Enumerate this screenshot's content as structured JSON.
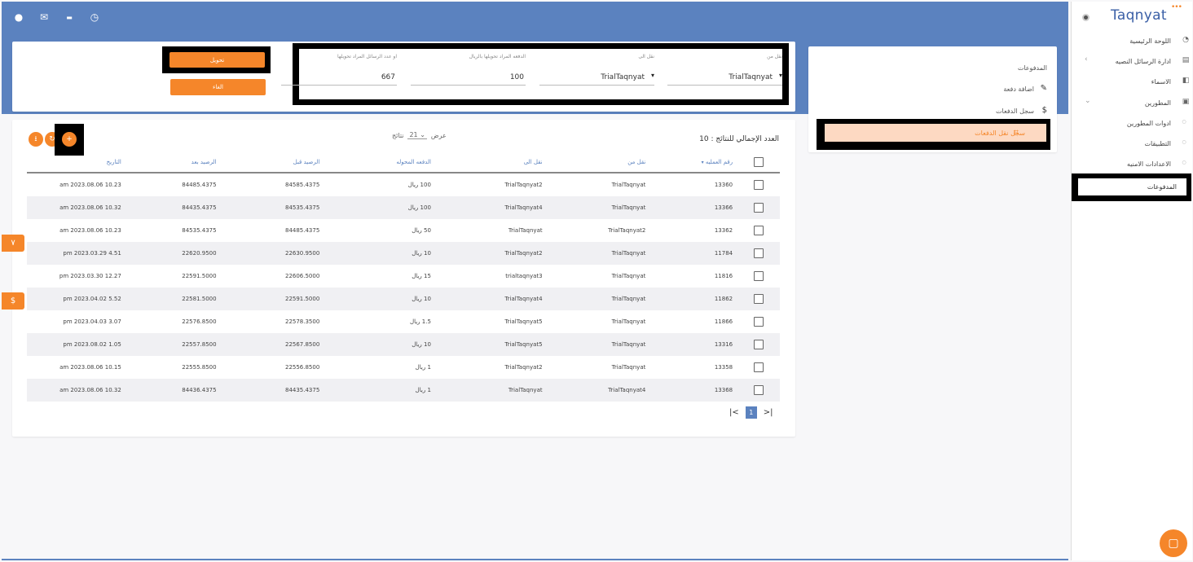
{
  "brand": {
    "name": "Taqnyat",
    "dots": "•••"
  },
  "topbar": {
    "icons": [
      "user-icon",
      "mail-icon",
      "flag-icon",
      "clock-icon"
    ]
  },
  "sidebar": {
    "items": [
      {
        "label": "اللوحة الرئيسية",
        "icon": "dashboard-icon"
      },
      {
        "label": "ادارة الرسائل النصيه",
        "icon": "message-icon"
      },
      {
        "label": "الاسماء",
        "icon": "book-icon"
      },
      {
        "label": "المطورين",
        "icon": "code-icon"
      },
      {
        "label": "ادوات المطورين",
        "icon": "bullet-icon"
      },
      {
        "label": "التطبيقات",
        "icon": "bullet-icon"
      },
      {
        "label": "الاعدادات الامنيه",
        "icon": "bullet-icon"
      },
      {
        "label": "المدفوعات",
        "icon": "bullet-icon"
      }
    ]
  },
  "form": {
    "transfer_button": "تحويل",
    "cancel_button": "الغاء",
    "fields": [
      {
        "label": "نقل من",
        "value": "TrialTaqnyat"
      },
      {
        "label": "نقل الى",
        "value": "TrialTaqnyat"
      },
      {
        "label": "الدفعه المراد تحويلها بالريال",
        "value": "100"
      },
      {
        "label": "او عدد الرسائل المراد تحويلها",
        "value": "667"
      }
    ]
  },
  "payments_card": {
    "title": "المدفوعات",
    "items": [
      {
        "label": "اضافة دفعة",
        "icon": "pencil-icon"
      },
      {
        "label": "سجل الدفعات",
        "icon": "dollar-icon"
      },
      {
        "label": "سجل نقل الدفعات",
        "icon": "crop-icon"
      }
    ]
  },
  "table": {
    "total_label": "العدد الإجمالي للنتائج : 10",
    "show_label": "عرض",
    "per_page": "21",
    "results_label": "نتائج",
    "columns": [
      "رقم العمليه",
      "نقل من",
      "نقل الى",
      "الدفعه المحوله",
      "الرصيد قبل",
      "الرصيد بعد",
      "التاريخ"
    ],
    "rows": [
      [
        "13360",
        "TrialTaqnyat",
        "TrialTaqnyat2",
        "100 ريال",
        "84585.4375",
        "84485.4375",
        "10.23 2023.08.06 am"
      ],
      [
        "13366",
        "TrialTaqnyat",
        "TrialTaqnyat4",
        "100 ريال",
        "84535.4375",
        "84435.4375",
        "10.32 2023.08.06 am"
      ],
      [
        "13362",
        "TrialTaqnyat2",
        "TrialTaqnyat",
        "50 ريال",
        "84485.4375",
        "84535.4375",
        "10.23 2023.08.06 am"
      ],
      [
        "11784",
        "TrialTaqnyat",
        "TrialTaqnyat2",
        "10 ريال",
        "22630.9500",
        "22620.9500",
        "4.51 2023.03.29 pm"
      ],
      [
        "11816",
        "TrialTaqnyat",
        "trialtaqnyat3",
        "15 ريال",
        "22606.5000",
        "22591.5000",
        "12.27 2023.03.30 pm"
      ],
      [
        "11862",
        "TrialTaqnyat",
        "TrialTaqnyat4",
        "10 ريال",
        "22591.5000",
        "22581.5000",
        "5.52 2023.04.02 pm"
      ],
      [
        "11866",
        "TrialTaqnyat",
        "TrialTaqnyat5",
        "1.5 ريال",
        "22578.3500",
        "22576.8500",
        "3.07 2023.04.03 pm"
      ],
      [
        "13316",
        "TrialTaqnyat",
        "TrialTaqnyat5",
        "10 ريال",
        "22567.8500",
        "22557.8500",
        "1.05 2023.08.02 pm"
      ],
      [
        "13358",
        "TrialTaqnyat",
        "TrialTaqnyat2",
        "1 ريال",
        "22556.8500",
        "22555.8500",
        "10.15 2023.08.06 am"
      ],
      [
        "13368",
        "TrialTaqnyat4",
        "TrialTaqnyat",
        "1 ريال",
        "84435.4375",
        "84436.4375",
        "10.32 2023.08.06 am"
      ]
    ],
    "page": "1"
  },
  "side_tabs": {
    "first": "٧",
    "second": "$"
  },
  "colors": {
    "accent": "#f5862a",
    "primary": "#5b82bf"
  }
}
